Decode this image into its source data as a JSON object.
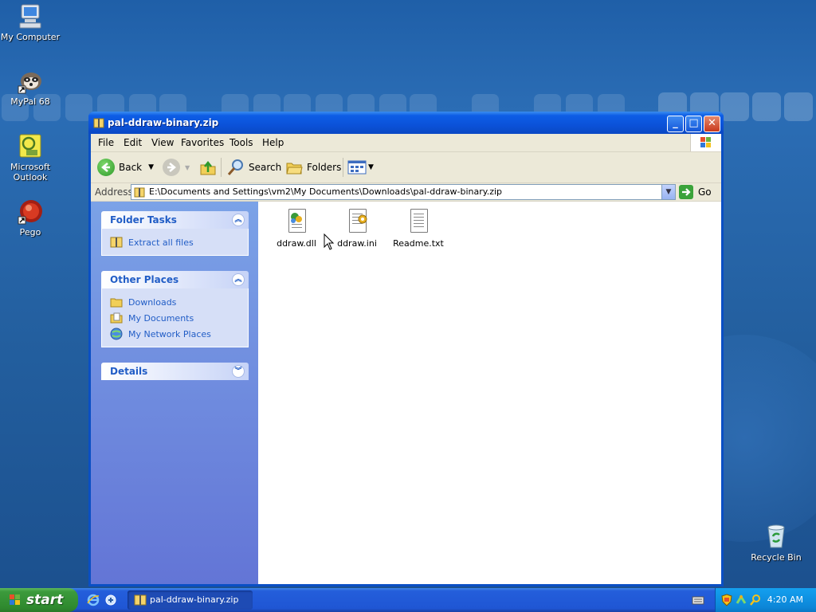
{
  "desktop": {
    "icons": [
      {
        "label": "My Computer",
        "icon": "my-computer-icon"
      },
      {
        "label": "MyPal 68",
        "icon": "mypal-raccoon-icon"
      },
      {
        "label": "Microsoft Outlook",
        "icon": "outlook-icon"
      },
      {
        "label": "Pego",
        "icon": "pego-icon"
      },
      {
        "label": "Recycle Bin",
        "icon": "recycle-bin-icon"
      }
    ]
  },
  "window": {
    "title": "pal-ddraw-binary.zip",
    "controls": {
      "minimize": "_",
      "maximize": "□",
      "close": "✕"
    }
  },
  "menubar": [
    "File",
    "Edit",
    "View",
    "Favorites",
    "Tools",
    "Help"
  ],
  "toolbar": {
    "back": "Back",
    "search": "Search",
    "folders": "Folders"
  },
  "address": {
    "label": "Address",
    "value": "E:\\Documents and Settings\\vm2\\My Documents\\Downloads\\pal-ddraw-binary.zip",
    "go": "Go"
  },
  "taskpane": {
    "folder_tasks": {
      "title": "Folder Tasks",
      "items": [
        "Extract all files"
      ]
    },
    "other_places": {
      "title": "Other Places",
      "items": [
        "Downloads",
        "My Documents",
        "My Network Places"
      ]
    },
    "details": {
      "title": "Details"
    }
  },
  "files": [
    {
      "name": "ddraw.dll",
      "icon": "dll-file-icon"
    },
    {
      "name": "ddraw.ini",
      "icon": "ini-file-icon"
    },
    {
      "name": "Readme.txt",
      "icon": "text-file-icon"
    }
  ],
  "taskbar": {
    "start": "start",
    "task_button": "pal-ddraw-binary.zip",
    "clock": "4:20 AM"
  },
  "colors": {
    "desktop": "#235f9f",
    "titlebar": "#0b52d9",
    "taskpane_link": "#215dc6",
    "start_green": "#3c9a3c"
  }
}
